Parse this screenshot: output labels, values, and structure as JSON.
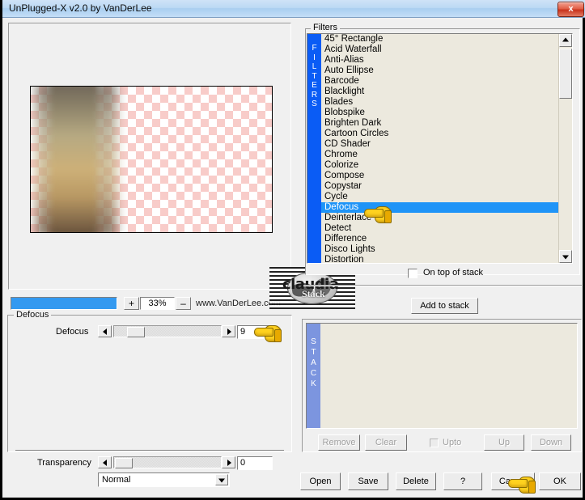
{
  "window": {
    "title": "UnPlugged-X v2.0 by VanDerLee",
    "close_label": "x"
  },
  "preview": {
    "zoom_value": "33%",
    "zoom_plus": "+",
    "zoom_minus": "–",
    "website": "www.VanDerLee.com"
  },
  "watermark": {
    "main": "claudia",
    "sub": "Stack"
  },
  "filters": {
    "legend": "Filters",
    "side_label": "FILTERS",
    "selected": "Defocus",
    "items": [
      "45° Rectangle",
      "Acid Waterfall",
      "Anti-Alias",
      "Auto Ellipse",
      "Barcode",
      "Blacklight",
      "Blades",
      "Blobspike",
      "Brighten Dark",
      "Cartoon Circles",
      "CD Shader",
      "Chrome",
      "Colorize",
      "Compose",
      "Copystar",
      "Cycle",
      "Defocus",
      "Deinterlace",
      "Detect",
      "Difference",
      "Disco Lights",
      "Distortion"
    ],
    "on_top_of_stack_label": "On top of stack",
    "on_top_of_stack_checked": false,
    "add_to_stack_label": "Add to stack"
  },
  "effect": {
    "group_title": "Defocus",
    "slider_label": "Defocus",
    "slider_value": "9",
    "transparency_label": "Transparency",
    "transparency_value": "0",
    "blend_mode": "Normal"
  },
  "stack": {
    "side_label": "STACK",
    "items": [],
    "remove_label": "Remove",
    "clear_label": "Clear",
    "upto_label": "Upto",
    "upto_checked": false,
    "up_label": "Up",
    "down_label": "Down"
  },
  "footer": {
    "open_label": "Open",
    "save_label": "Save",
    "delete_label": "Delete",
    "help_label": "?",
    "cancel_label": "Cancel",
    "ok_label": "OK"
  },
  "colors": {
    "titlebar": "#bcd9f4",
    "selection": "#1f94f7",
    "list_bg": "#ece9de",
    "filters_sidebar": "#0a5cf5",
    "stack_sidebar": "#7c95df",
    "zoom_fill": "#3399f0",
    "dialog_bg": "#f0f0f0",
    "close_button": "#c8321c"
  }
}
